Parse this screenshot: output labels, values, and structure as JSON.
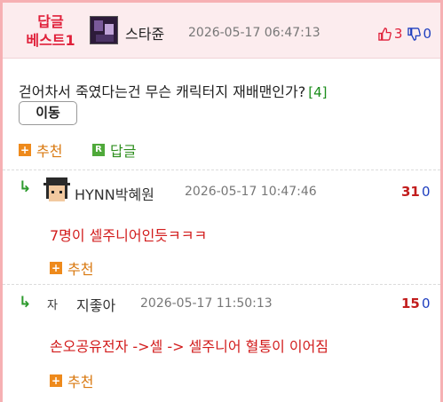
{
  "header": {
    "badge_line1": "답글",
    "badge_line2": "베스트1",
    "nickname": "스타쥰",
    "date": "2026-05-17 06:47:13",
    "up_count": "3",
    "down_count": "0",
    "thumb_up_icon": "thumbs-up-icon",
    "thumb_down_icon": "thumbs-down-icon"
  },
  "post": {
    "text": "걷어차서 죽였다는건 무슨 캐릭터지 재배맨인가?",
    "reply_count": "[4]",
    "move_label": "이동",
    "recommend_label": "추천",
    "reply_label": "답글",
    "plus_glyph": "+",
    "r_glyph": "R"
  },
  "replies": [
    {
      "arrow": "↳",
      "nickname": "HYNN박혜원",
      "date": "2026-05-17 10:47:46",
      "up": "31",
      "down": "0",
      "text": "7명이 셀주니어인듯ㅋㅋㅋ",
      "recommend_label": "추천"
    },
    {
      "arrow": "↳",
      "avatar_char": "자",
      "nickname": "지좋아",
      "date": "2026-05-17 11:50:13",
      "up": "15",
      "down": "0",
      "text": "손오공유전자 ->셀 -> 셀주니어 혈통이 이어짐",
      "recommend_label": "추천"
    }
  ],
  "colors": {
    "accent_red": "#e0203a",
    "header_bg": "#fcecee",
    "frame": "#f6b0b3",
    "orange": "#ee8a1c",
    "green": "#4fa93a",
    "blue": "#1f3fbf"
  }
}
